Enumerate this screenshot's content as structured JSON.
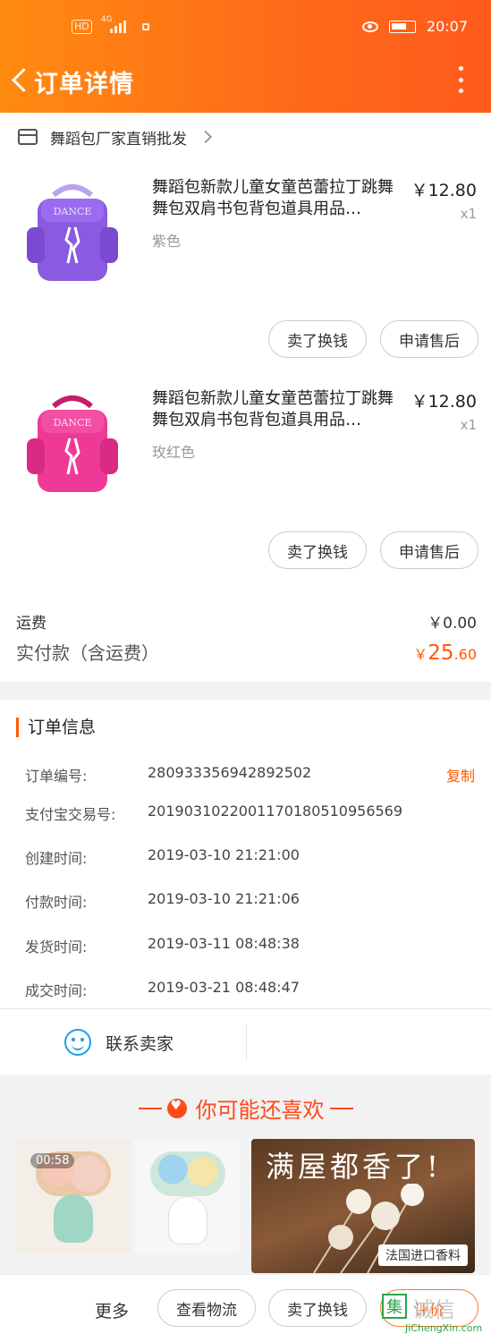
{
  "status_bar": {
    "hd": "HD",
    "network": "4G",
    "time": "20:07"
  },
  "header": {
    "title": "订单详情"
  },
  "shop": {
    "name": "舞蹈包厂家直销批发"
  },
  "products": [
    {
      "name": "舞蹈包新款儿童女童芭蕾拉丁跳舞舞包双肩书包背包道具用品…",
      "price": "￥12.80",
      "qty": "x1",
      "sku": "紫色",
      "color": "#8a5ae0",
      "img_text": "DANCE",
      "btn_sell": "卖了换钱",
      "btn_service": "申请售后"
    },
    {
      "name": "舞蹈包新款儿童女童芭蕾拉丁跳舞舞包双肩书包背包道具用品…",
      "price": "￥12.80",
      "qty": "x1",
      "sku": "玫红色",
      "color": "#ee3a96",
      "img_text": "DANCE",
      "btn_sell": "卖了换钱",
      "btn_service": "申请售后"
    }
  ],
  "fees": {
    "shipping_label": "运费",
    "shipping_value": "￥0.00",
    "paid_label": "实付款（含运费）",
    "paid_currency": "￥",
    "paid_int": "25",
    "paid_dec": ".60"
  },
  "order_info": {
    "title": "订单信息",
    "copy_label": "复制",
    "rows": [
      {
        "key": "订单编号:",
        "value": "280933356942892502"
      },
      {
        "key": "支付宝交易号:",
        "value": "2019031022001170180510956569"
      },
      {
        "key": "创建时间:",
        "value": "2019-03-10 21:21:00"
      },
      {
        "key": "付款时间:",
        "value": "2019-03-10 21:21:06"
      },
      {
        "key": "发货时间:",
        "value": "2019-03-11 08:48:38"
      },
      {
        "key": "成交时间:",
        "value": "2019-03-21 08:48:47"
      }
    ]
  },
  "contact": {
    "label": "联系卖家"
  },
  "recommend": {
    "title": "你可能还喜欢",
    "video_time": "00:58",
    "ad_title": "满屋都香了!",
    "ad_tag": "法国进口香料"
  },
  "bottom_bar": {
    "more": "更多",
    "logistics": "查看物流",
    "sell": "卖了换钱",
    "review": "评价"
  },
  "watermark": {
    "main": "诚信",
    "box": "集",
    "sub": "JiChengXin.com"
  },
  "colors": {
    "accent": "#ff5a00",
    "header_start": "#ff8a10",
    "header_end": "#ff5a1c"
  }
}
